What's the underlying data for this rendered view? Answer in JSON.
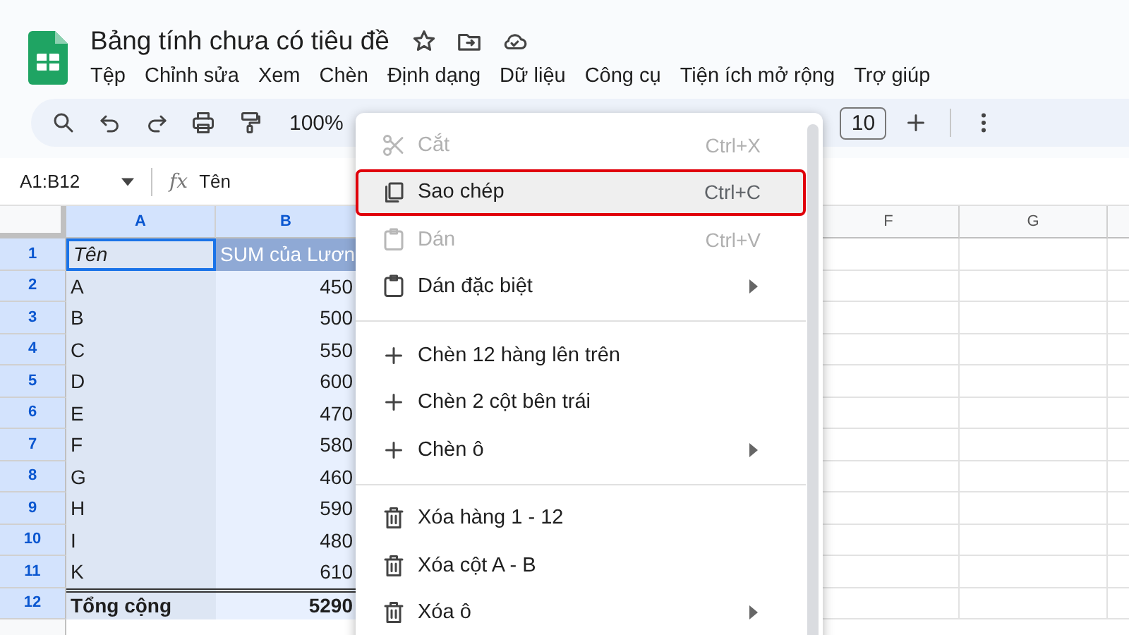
{
  "document": {
    "title": "Bảng tính chưa có tiêu đề"
  },
  "menu_bar": [
    "Tệp",
    "Chỉnh sửa",
    "Xem",
    "Chèn",
    "Định dạng",
    "Dữ liệu",
    "Công cụ",
    "Tiện ích mở rộng",
    "Trợ giúp"
  ],
  "toolbar": {
    "zoom": "100%",
    "font_size": "10"
  },
  "formula_bar": {
    "name_box": "A1:B12",
    "function_label": "fx",
    "formula": "Tên"
  },
  "grid": {
    "columns": [
      {
        "label": "A",
        "selected": true
      },
      {
        "label": "B",
        "selected": true
      },
      {
        "label": "F",
        "selected": false
      },
      {
        "label": "G",
        "selected": false
      }
    ],
    "rows": [
      {
        "number": "1",
        "kind": "header",
        "selected": true,
        "cells": [
          "Tên",
          "SUM của Lươn"
        ]
      },
      {
        "number": "2",
        "kind": "data",
        "selected": true,
        "cells": [
          "A",
          "450"
        ]
      },
      {
        "number": "3",
        "kind": "data",
        "selected": true,
        "cells": [
          "B",
          "500"
        ]
      },
      {
        "number": "4",
        "kind": "data",
        "selected": true,
        "cells": [
          "C",
          "550"
        ]
      },
      {
        "number": "5",
        "kind": "data",
        "selected": true,
        "cells": [
          "D",
          "600"
        ]
      },
      {
        "number": "6",
        "kind": "data",
        "selected": true,
        "cells": [
          "E",
          "470"
        ]
      },
      {
        "number": "7",
        "kind": "data",
        "selected": true,
        "cells": [
          "F",
          "580"
        ]
      },
      {
        "number": "8",
        "kind": "data",
        "selected": true,
        "cells": [
          "G",
          "460"
        ]
      },
      {
        "number": "9",
        "kind": "data",
        "selected": true,
        "cells": [
          "H",
          "590"
        ]
      },
      {
        "number": "10",
        "kind": "data",
        "selected": true,
        "cells": [
          "I",
          "480"
        ]
      },
      {
        "number": "11",
        "kind": "data",
        "selected": true,
        "cells": [
          "K",
          "610"
        ]
      },
      {
        "number": "12",
        "kind": "total",
        "selected": true,
        "cells": [
          "Tổng cộng",
          "5290"
        ]
      }
    ]
  },
  "context_menu": {
    "items": [
      {
        "kind": "cut",
        "label": "Cắt",
        "shortcut": "Ctrl+X",
        "disabled": true,
        "selected": false
      },
      {
        "kind": "copy",
        "label": "Sao chép",
        "shortcut": "Ctrl+C",
        "disabled": false,
        "selected": true
      },
      {
        "kind": "paste",
        "label": "Dán",
        "shortcut": "Ctrl+V",
        "disabled": true,
        "selected": false
      },
      {
        "kind": "paste",
        "label": "Dán đặc biệt",
        "submenu": true,
        "disabled": false,
        "selected": false
      },
      {
        "kind": "divider"
      },
      {
        "kind": "insert",
        "label": "Chèn 12 hàng lên trên",
        "disabled": false,
        "selected": false
      },
      {
        "kind": "insert",
        "label": "Chèn 2 cột bên trái",
        "disabled": false,
        "selected": false
      },
      {
        "kind": "insert",
        "label": "Chèn ô",
        "submenu": true,
        "disabled": false,
        "selected": false
      },
      {
        "kind": "divider"
      },
      {
        "kind": "delete",
        "label": "Xóa hàng 1 - 12",
        "disabled": false,
        "selected": false
      },
      {
        "kind": "delete",
        "label": "Xóa cột A - B",
        "disabled": false,
        "selected": false
      },
      {
        "kind": "delete",
        "label": "Xóa ô",
        "submenu": true,
        "disabled": false,
        "selected": false
      }
    ]
  }
}
